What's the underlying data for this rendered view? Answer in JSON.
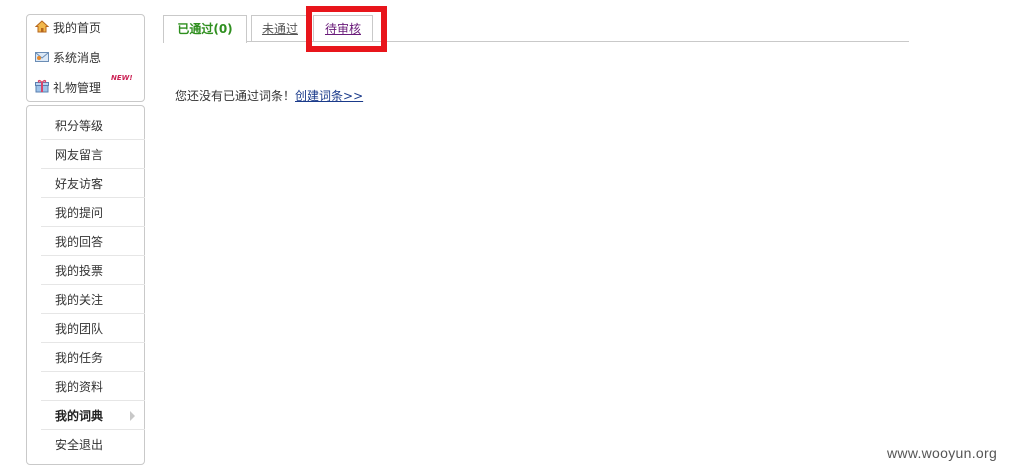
{
  "sidebar": {
    "top_items": [
      {
        "label": "我的首页",
        "icon": "home-icon"
      },
      {
        "label": "系统消息",
        "icon": "message-icon"
      },
      {
        "label": "礼物管理",
        "icon": "gift-icon",
        "badge": "NEW!"
      }
    ],
    "menu_items": [
      {
        "label": "积分等级"
      },
      {
        "label": "网友留言"
      },
      {
        "label": "好友访客"
      },
      {
        "label": "我的提问"
      },
      {
        "label": "我的回答"
      },
      {
        "label": "我的投票"
      },
      {
        "label": "我的关注"
      },
      {
        "label": "我的团队"
      },
      {
        "label": "我的任务"
      },
      {
        "label": "我的资料"
      },
      {
        "label": "我的词典",
        "active": true
      },
      {
        "label": "安全退出"
      }
    ]
  },
  "tabs": [
    {
      "label": "已通过(0)",
      "active": true
    },
    {
      "label": "未通过",
      "active": false
    },
    {
      "label": "待审核",
      "active": false
    }
  ],
  "content": {
    "notice": "您还没有已通过词条！",
    "create_link": "创建词条>>"
  },
  "watermark": "www.wooyun.org",
  "colors": {
    "active_tab": "#2f8f1f",
    "highlight": "#e8151b",
    "link": "#1a3a8a"
  }
}
